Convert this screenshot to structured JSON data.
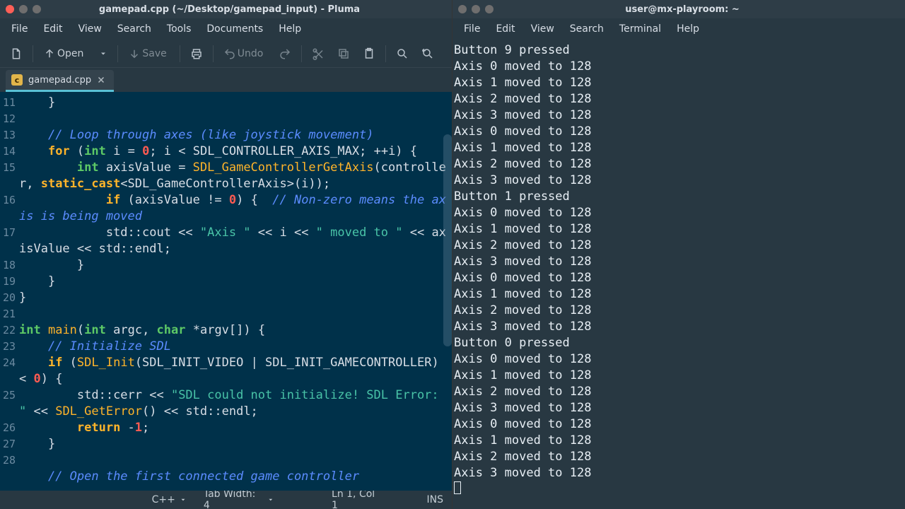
{
  "left": {
    "title": "gamepad.cpp (~/Desktop/gamepad_input) - Pluma",
    "menus": [
      "File",
      "Edit",
      "View",
      "Search",
      "Tools",
      "Documents",
      "Help"
    ],
    "toolbar": {
      "open": "Open",
      "save": "Save",
      "undo": "Undo"
    },
    "tab": {
      "label": "gamepad.cpp",
      "badge": "c"
    },
    "gutter": [
      "11",
      "12",
      "13",
      "14",
      "15",
      "",
      "16",
      "",
      "17",
      "",
      "18",
      "19",
      "20",
      "21",
      "22",
      "23",
      "24",
      "",
      "25",
      "",
      "26",
      "27",
      "28",
      ""
    ],
    "code": [
      [
        [
          "",
          "    }"
        ]
      ],
      [
        [
          "",
          ""
        ]
      ],
      [
        [
          "",
          "    "
        ],
        [
          "cmt",
          "// Loop through axes (like joystick movement)"
        ]
      ],
      [
        [
          "",
          "    "
        ],
        [
          "kw",
          "for"
        ],
        [
          "",
          " ("
        ],
        [
          "type",
          "int"
        ],
        [
          "",
          " i = "
        ],
        [
          "num",
          "0"
        ],
        [
          "",
          "; i < SDL_CONTROLLER_AXIS_MAX; ++i) {"
        ]
      ],
      [
        [
          "",
          "        "
        ],
        [
          "type",
          "int"
        ],
        [
          "",
          " axisValue = "
        ],
        [
          "func",
          "SDL_GameControllerGetAxis"
        ],
        [
          "",
          "(controller, "
        ],
        [
          "kw",
          "static_cast"
        ],
        [
          "",
          "<SDL_GameControllerAxis>(i));"
        ]
      ],
      [
        [
          "",
          "            "
        ],
        [
          "kw",
          "if"
        ],
        [
          "",
          " (axisValue != "
        ],
        [
          "num",
          "0"
        ],
        [
          "",
          ") {  "
        ],
        [
          "cmt",
          "// Non-zero means the axis is being moved"
        ]
      ],
      [
        [
          "",
          "            std::cout << "
        ],
        [
          "str",
          "\"Axis \""
        ],
        [
          "",
          " << i << "
        ],
        [
          "str",
          "\" moved to \""
        ],
        [
          "",
          " << axisValue << std::endl;"
        ]
      ],
      [
        [
          "",
          "        }"
        ]
      ],
      [
        [
          "",
          "    }"
        ]
      ],
      [
        [
          "",
          "}"
        ]
      ],
      [
        [
          "",
          ""
        ]
      ],
      [
        [
          "type",
          "int"
        ],
        [
          "",
          " "
        ],
        [
          "func",
          "main"
        ],
        [
          "",
          "("
        ],
        [
          "type",
          "int"
        ],
        [
          "",
          " argc, "
        ],
        [
          "type",
          "char"
        ],
        [
          "",
          " *argv[]) {"
        ]
      ],
      [
        [
          "",
          "    "
        ],
        [
          "cmt",
          "// Initialize SDL"
        ]
      ],
      [
        [
          "",
          "    "
        ],
        [
          "kw",
          "if"
        ],
        [
          "",
          " ("
        ],
        [
          "func",
          "SDL_Init"
        ],
        [
          "",
          "(SDL_INIT_VIDEO | SDL_INIT_GAMECONTROLLER) < "
        ],
        [
          "num",
          "0"
        ],
        [
          "",
          ") {"
        ]
      ],
      [
        [
          "",
          "        std::cerr << "
        ],
        [
          "str",
          "\"SDL could not initialize! SDL Error: \""
        ],
        [
          "",
          " << "
        ],
        [
          "func",
          "SDL_GetError"
        ],
        [
          "",
          "() << std::endl;"
        ]
      ],
      [
        [
          "",
          "        "
        ],
        [
          "kw",
          "return"
        ],
        [
          "",
          " -"
        ],
        [
          "num",
          "1"
        ],
        [
          "",
          ";"
        ]
      ],
      [
        [
          "",
          "    }"
        ]
      ],
      [
        [
          "",
          ""
        ]
      ],
      [
        [
          "",
          "    "
        ],
        [
          "cmt",
          "// Open the first connected game controller"
        ]
      ]
    ],
    "statusbar": {
      "lang": "C++",
      "tabwidth_label": "Tab Width: 4",
      "pos": "Ln 1, Col 1",
      "ins": "INS"
    }
  },
  "right": {
    "title": "user@mx-playroom: ~",
    "menus": [
      "File",
      "Edit",
      "View",
      "Search",
      "Terminal",
      "Help"
    ],
    "lines": [
      "Button 9 pressed",
      "Axis 0 moved to 128",
      "Axis 1 moved to 128",
      "Axis 2 moved to 128",
      "Axis 3 moved to 128",
      "Axis 0 moved to 128",
      "Axis 1 moved to 128",
      "Axis 2 moved to 128",
      "Axis 3 moved to 128",
      "Button 1 pressed",
      "Axis 0 moved to 128",
      "Axis 1 moved to 128",
      "Axis 2 moved to 128",
      "Axis 3 moved to 128",
      "Axis 0 moved to 128",
      "Axis 1 moved to 128",
      "Axis 2 moved to 128",
      "Axis 3 moved to 128",
      "Button 0 pressed",
      "Axis 0 moved to 128",
      "Axis 1 moved to 128",
      "Axis 2 moved to 128",
      "Axis 3 moved to 128",
      "Axis 0 moved to 128",
      "Axis 1 moved to 128",
      "Axis 2 moved to 128",
      "Axis 3 moved to 128"
    ]
  }
}
